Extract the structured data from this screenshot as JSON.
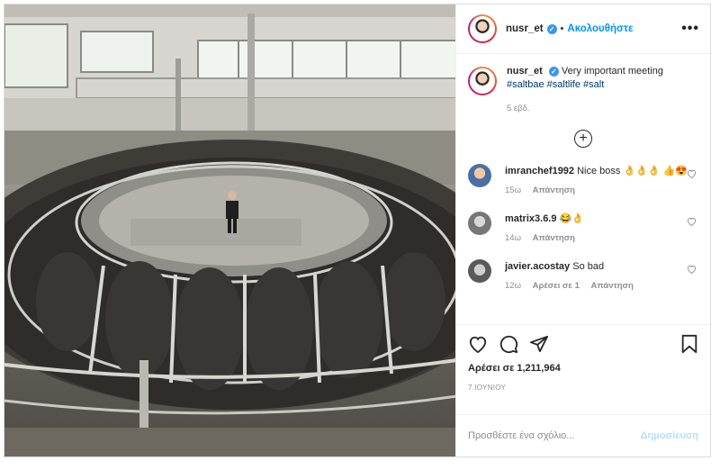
{
  "post": {
    "author": {
      "username": "nusr_et",
      "verified_icon": "verified-badge-icon",
      "follow_label": "Ακολουθήστε",
      "dot": "•"
    },
    "more_icon": "more-options-icon",
    "caption": {
      "username": "nusr_et",
      "text": "Very important meeting",
      "hashtags": [
        "#saltbae",
        "#saltlife",
        "#salt"
      ],
      "time": "5 εβδ."
    },
    "load_more_icon": "plus-circle-icon",
    "comments": [
      {
        "username": "imranchef1992",
        "text": "Nice boss 👌👌👌 👍😍",
        "time": "15ω",
        "reply_label": "Απάντηση",
        "likes": "",
        "avatar_color": "#4a6fa5"
      },
      {
        "username": "matrix3.6.9",
        "text": "😂👌",
        "time": "14ω",
        "reply_label": "Απάντηση",
        "likes": "",
        "avatar_color": "#777777"
      },
      {
        "username": "javier.acostay",
        "text": "So bad",
        "time": "12ω",
        "likes": "Αρέσει σε 1",
        "reply_label": "Απάντηση",
        "avatar_color": "#5a5a5a"
      }
    ],
    "actions": {
      "like_icon": "heart-icon",
      "comment_icon": "comment-icon",
      "share_icon": "share-icon",
      "save_icon": "bookmark-icon"
    },
    "likes_text": "Αρέσει σε 1,211,964",
    "date": "7 ΙΟΥΝΙΟΥ",
    "add_comment": {
      "placeholder": "Προσθέστε ένα σχόλιο...",
      "publish_label": "Δημοσίευση"
    },
    "colors": {
      "link": "#0095f6",
      "verified": "#3897f0",
      "hashtag": "#00376b",
      "muted": "#8e8e8e",
      "publish_disabled": "#b2dffc"
    }
  }
}
